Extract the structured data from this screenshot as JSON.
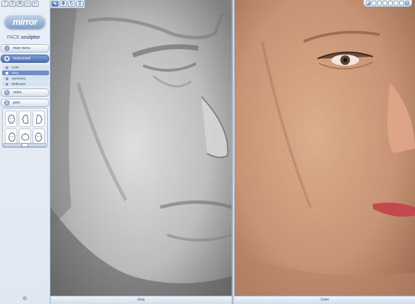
{
  "app": {
    "logo_text": "mirror",
    "subtitle_prefix": "FACE",
    "subtitle_main": "sculptor",
    "top_icons": [
      "help-icon",
      "search-icon",
      "settings-icon",
      "window-icon",
      "back-icon"
    ]
  },
  "menu": {
    "items": [
      {
        "label": "main menu",
        "icon": "home-icon"
      },
      {
        "label": "enviroment",
        "icon": "globe-icon",
        "active": true,
        "sub": [
          {
            "label": "Color"
          },
          {
            "label": "Grey",
            "active": true
          },
          {
            "label": "Symmetry"
          },
          {
            "label": "Reflection"
          }
        ]
      },
      {
        "label": "notes",
        "icon": "note-icon"
      },
      {
        "label": "print",
        "icon": "printer-icon"
      }
    ]
  },
  "face_views": [
    "front",
    "left-profile",
    "right-profile",
    "three-quarter-left",
    "top",
    "three-quarter-right"
  ],
  "viewports": {
    "grey_label": "Grey",
    "color_label": "Color",
    "tools": [
      "cursor-icon",
      "move-icon",
      "rotate-icon",
      "zoom-icon"
    ]
  },
  "colors": {
    "accent": "#4a72b5",
    "sidebar_bg": "#e4ebf4",
    "border": "#9fb1c8"
  }
}
